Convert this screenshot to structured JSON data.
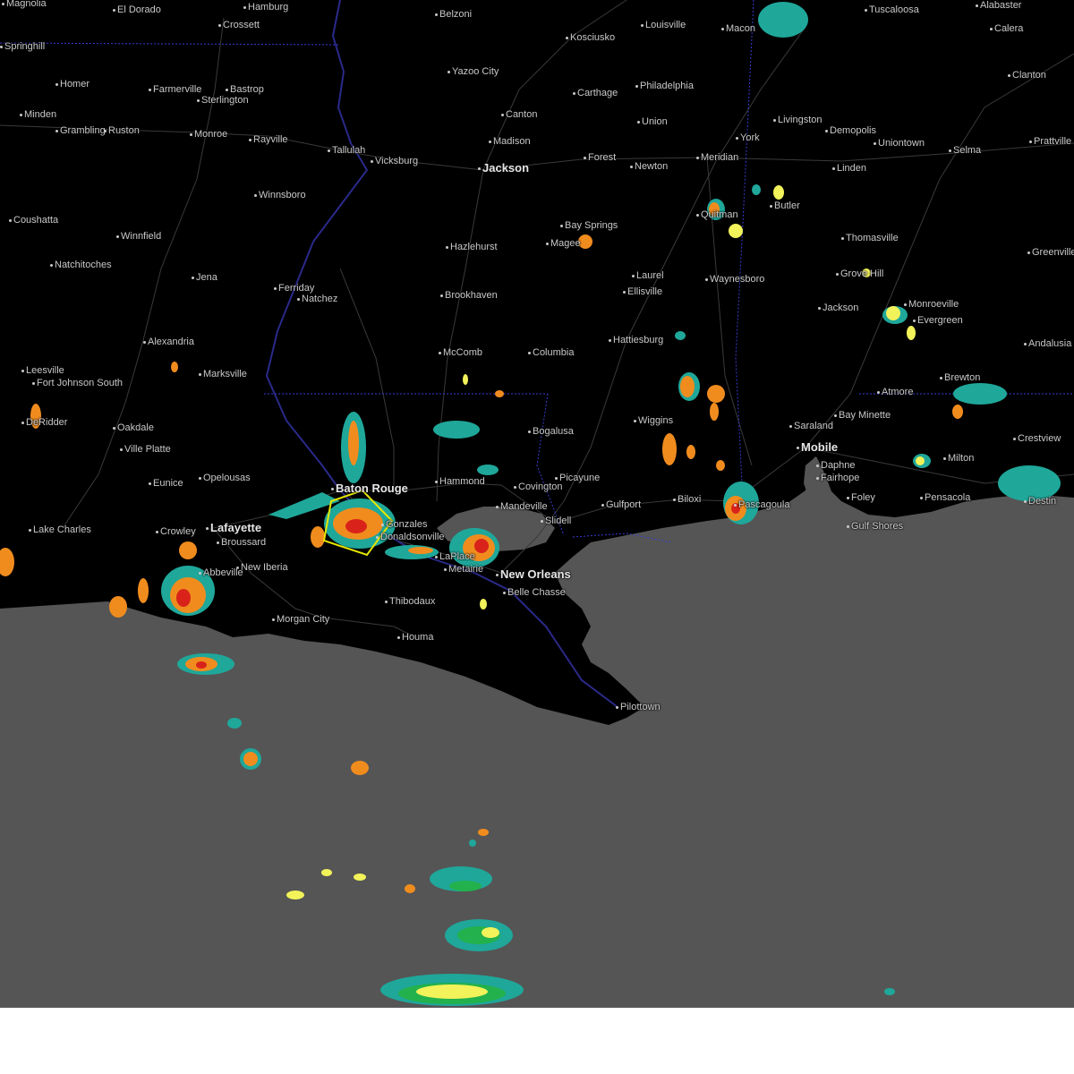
{
  "map": {
    "colors": {
      "land": "#000000",
      "water": "#555555",
      "roads": "#3a3a3a",
      "state_border": "#3b3bd0",
      "river": "#2a2a8a",
      "warning_polygon": "#e6e600",
      "radar_light": "#1fa79a",
      "radar_green": "#22b14c",
      "radar_yellow": "#f2f25a",
      "radar_orange": "#f08c1e",
      "radar_red": "#d9231a"
    },
    "cities": [
      {
        "name": "Magnolia"
      },
      {
        "name": "El Dorado"
      },
      {
        "name": "Hamburg"
      },
      {
        "name": "Crossett"
      },
      {
        "name": "Belzoni"
      },
      {
        "name": "Kosciusko"
      },
      {
        "name": "Louisville"
      },
      {
        "name": "Macon"
      },
      {
        "name": "Tuscaloosa"
      },
      {
        "name": "Alabaster"
      },
      {
        "name": "Calera"
      },
      {
        "name": "Springhill"
      },
      {
        "name": "Homer"
      },
      {
        "name": "Farmerville"
      },
      {
        "name": "Bastrop"
      },
      {
        "name": "Sterlington"
      },
      {
        "name": "Yazoo City"
      },
      {
        "name": "Carthage"
      },
      {
        "name": "Philadelphia"
      },
      {
        "name": "Clanton"
      },
      {
        "name": "Minden"
      },
      {
        "name": "Grambling"
      },
      {
        "name": "Ruston"
      },
      {
        "name": "Monroe"
      },
      {
        "name": "Rayville"
      },
      {
        "name": "Tallulah"
      },
      {
        "name": "Vicksburg"
      },
      {
        "name": "Canton"
      },
      {
        "name": "Madison"
      },
      {
        "name": "Union"
      },
      {
        "name": "Livingston"
      },
      {
        "name": "Demopolis"
      },
      {
        "name": "York"
      },
      {
        "name": "Uniontown"
      },
      {
        "name": "Prattville"
      },
      {
        "name": "Jackson"
      },
      {
        "name": "Forest"
      },
      {
        "name": "Newton"
      },
      {
        "name": "Meridian"
      },
      {
        "name": "Selma"
      },
      {
        "name": "Linden"
      },
      {
        "name": "Winnsboro"
      },
      {
        "name": "Coushatta"
      },
      {
        "name": "Winnfield"
      },
      {
        "name": "Bay Springs"
      },
      {
        "name": "Magee"
      },
      {
        "name": "Hazlehurst"
      },
      {
        "name": "Quitman"
      },
      {
        "name": "Butler"
      },
      {
        "name": "Thomasville"
      },
      {
        "name": "Greenville"
      },
      {
        "name": "Natchitoches"
      },
      {
        "name": "Jena"
      },
      {
        "name": "Ferriday"
      },
      {
        "name": "Natchez"
      },
      {
        "name": "Brookhaven"
      },
      {
        "name": "Laurel"
      },
      {
        "name": "Ellisville"
      },
      {
        "name": "Waynesboro"
      },
      {
        "name": "Grove Hill"
      },
      {
        "name": "Jackson"
      },
      {
        "name": "Monroeville"
      },
      {
        "name": "Evergreen"
      },
      {
        "name": "Alexandria"
      },
      {
        "name": "Marksville"
      },
      {
        "name": "McComb"
      },
      {
        "name": "Columbia"
      },
      {
        "name": "Hattiesburg"
      },
      {
        "name": "Andalusia"
      },
      {
        "name": "Leesville"
      },
      {
        "name": "Fort Johnson South"
      },
      {
        "name": "Atmore"
      },
      {
        "name": "Brewton"
      },
      {
        "name": "DeRidder"
      },
      {
        "name": "Oakdale"
      },
      {
        "name": "Bogalusa"
      },
      {
        "name": "Wiggins"
      },
      {
        "name": "Bay Minette"
      },
      {
        "name": "Saraland"
      },
      {
        "name": "Crestview"
      },
      {
        "name": "Ville Platte"
      },
      {
        "name": "Mobile"
      },
      {
        "name": "Milton"
      },
      {
        "name": "Daphne"
      },
      {
        "name": "Fairhope"
      },
      {
        "name": "Eunice"
      },
      {
        "name": "Opelousas"
      },
      {
        "name": "Hammond"
      },
      {
        "name": "Covington"
      },
      {
        "name": "Picayune"
      },
      {
        "name": "Baton Rouge"
      },
      {
        "name": "Mandeville"
      },
      {
        "name": "Gulfport"
      },
      {
        "name": "Biloxi"
      },
      {
        "name": "Pascagoula"
      },
      {
        "name": "Foley"
      },
      {
        "name": "Pensacola"
      },
      {
        "name": "Destin"
      },
      {
        "name": "Slidell"
      },
      {
        "name": "Gulf Shores"
      },
      {
        "name": "Lake Charles"
      },
      {
        "name": "Crowley"
      },
      {
        "name": "Lafayette"
      },
      {
        "name": "Broussard"
      },
      {
        "name": "Gonzales"
      },
      {
        "name": "Donaldsonville"
      },
      {
        "name": "LaPlace"
      },
      {
        "name": "Metairie"
      },
      {
        "name": "New Orleans"
      },
      {
        "name": "New Iberia"
      },
      {
        "name": "Abbeville"
      },
      {
        "name": "Belle Chasse"
      },
      {
        "name": "Thibodaux"
      },
      {
        "name": "Morgan City"
      },
      {
        "name": "Houma"
      },
      {
        "name": "Pilottown"
      }
    ]
  }
}
